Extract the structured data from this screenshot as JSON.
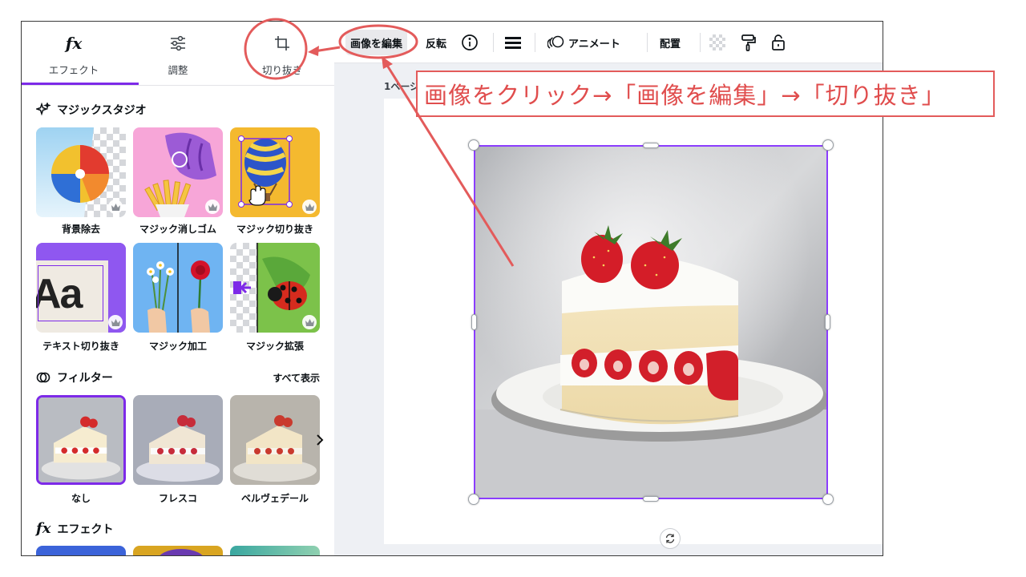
{
  "tabs": [
    {
      "label": "エフェクト",
      "icon": "fx-icon"
    },
    {
      "label": "調整",
      "icon": "sliders-icon"
    },
    {
      "label": "切り抜き",
      "icon": "crop-icon"
    }
  ],
  "magic_studio": {
    "title": "マジックスタジオ",
    "tiles": [
      {
        "label": "背景除去"
      },
      {
        "label": "マジック消しゴム"
      },
      {
        "label": "マジック切り抜き"
      },
      {
        "label": "テキスト切り抜き",
        "text": "Aa"
      },
      {
        "label": "マジック加工"
      },
      {
        "label": "マジック拡張"
      }
    ]
  },
  "filters": {
    "title": "フィルター",
    "see_all": "すべて表示",
    "items": [
      {
        "label": "なし",
        "selected": true
      },
      {
        "label": "フレスコ",
        "selected": false
      },
      {
        "label": "ベルヴェデール",
        "selected": false
      }
    ]
  },
  "effects_section": {
    "title": "エフェクト",
    "icon_text": "fx"
  },
  "toolbar": {
    "edit_image": "画像を編集",
    "flip": "反転",
    "animate": "アニメート",
    "position": "配置"
  },
  "canvas": {
    "page_label": "1ページ"
  },
  "annotation": {
    "text": "画像をクリック→「画像を編集」→「切り抜き」"
  },
  "colors": {
    "accent": "#7d2ae8",
    "annotation": "#e35b5b"
  }
}
